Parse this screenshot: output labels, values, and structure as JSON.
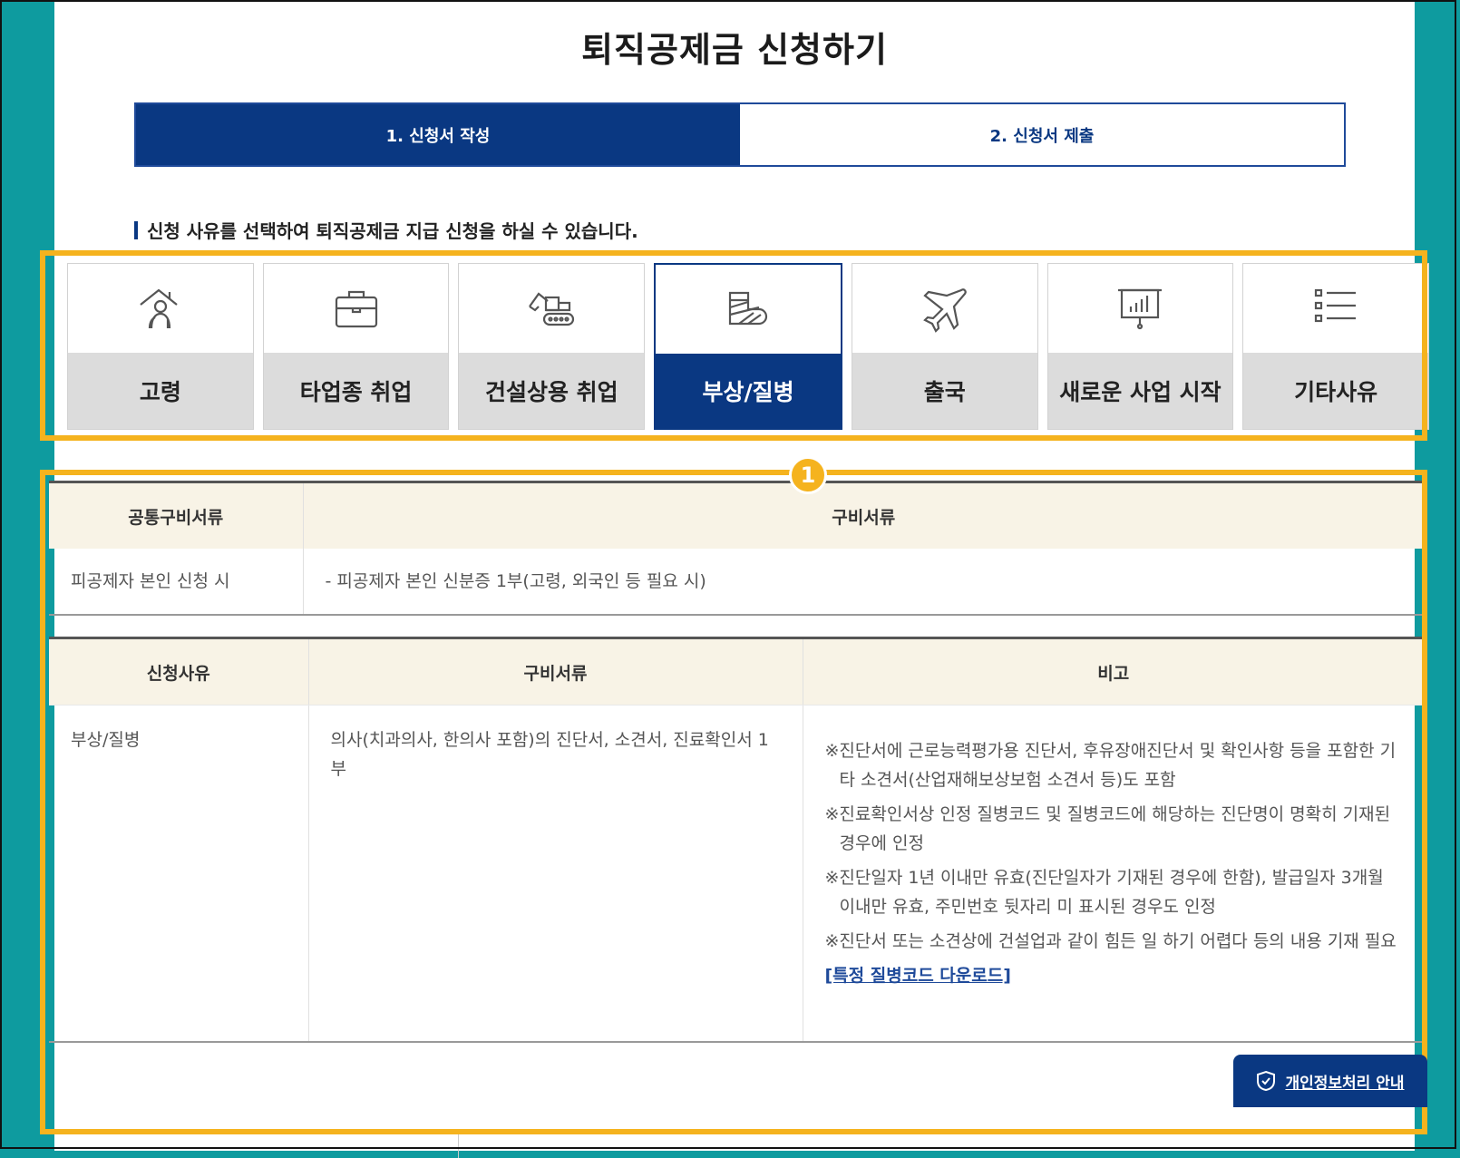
{
  "page": {
    "title": "퇴직공제금 신청하기"
  },
  "steps": [
    {
      "label": "1. 신청서 작성",
      "active": true
    },
    {
      "label": "2. 신청서 제출",
      "active": false
    }
  ],
  "guide_text": "신청 사유를 선택하여 퇴직공제금 지급 신청을 하실 수 있습니다.",
  "reasons": [
    {
      "label": "고령",
      "icon": "elderly-person-icon",
      "selected": false
    },
    {
      "label": "타업종 취업",
      "icon": "briefcase-icon",
      "selected": false
    },
    {
      "label": "건설상용 취업",
      "icon": "excavator-icon",
      "selected": false
    },
    {
      "label": "부상/질병",
      "icon": "cast-arm-icon",
      "selected": true
    },
    {
      "label": "출국",
      "icon": "airplane-icon",
      "selected": false
    },
    {
      "label": "새로운 사업 시작",
      "icon": "presentation-board-icon",
      "selected": false
    },
    {
      "label": "기타사유",
      "icon": "list-icon",
      "selected": false
    }
  ],
  "badge": "1",
  "common_docs": {
    "headers": [
      "공통구비서류",
      "구비서류"
    ],
    "row": {
      "case": "피공제자 본인 신청 시",
      "doc": "- 피공제자 본인 신분증 1부(고령, 외국인 등 필요 시)"
    }
  },
  "reason_docs": {
    "headers": [
      "신청사유",
      "구비서류",
      "비고"
    ],
    "row": {
      "reason": "부상/질병",
      "docs": "의사(치과의사, 한의사 포함)의 진단서, 소견서, 진료확인서 1부",
      "notes": [
        "※진단서에 근로능력평가용 진단서, 후유장애진단서 및 확인사항 등을 포함한 기타 소견서(산업재해보상보험 소견서 등)도 포함",
        "※진료확인서상 인정 질병코드 및 질병코드에 해당하는 진단명이 명확히 기재된 경우에 인정",
        "※진단일자 1년 이내만 유효(진단일자가 기재된 경우에 한함), 발급일자 3개월 이내만 유효, 주민번호 뒷자리 미 표시된 경우도 인정",
        "※진단서 또는 소견상에 건설업과 같이 힘든 일 하기 어렵다 등의 내용 기재 필요"
      ],
      "link": "[특정 질병코드 다운로드]"
    }
  },
  "privacy_button": {
    "label": "개인정보처리 안내",
    "icon": "shield-icon"
  },
  "colors": {
    "navy": "#0a3882",
    "highlight": "#f5b31e",
    "background": "#0e9b9f",
    "header_bg": "#f8f3e6"
  }
}
